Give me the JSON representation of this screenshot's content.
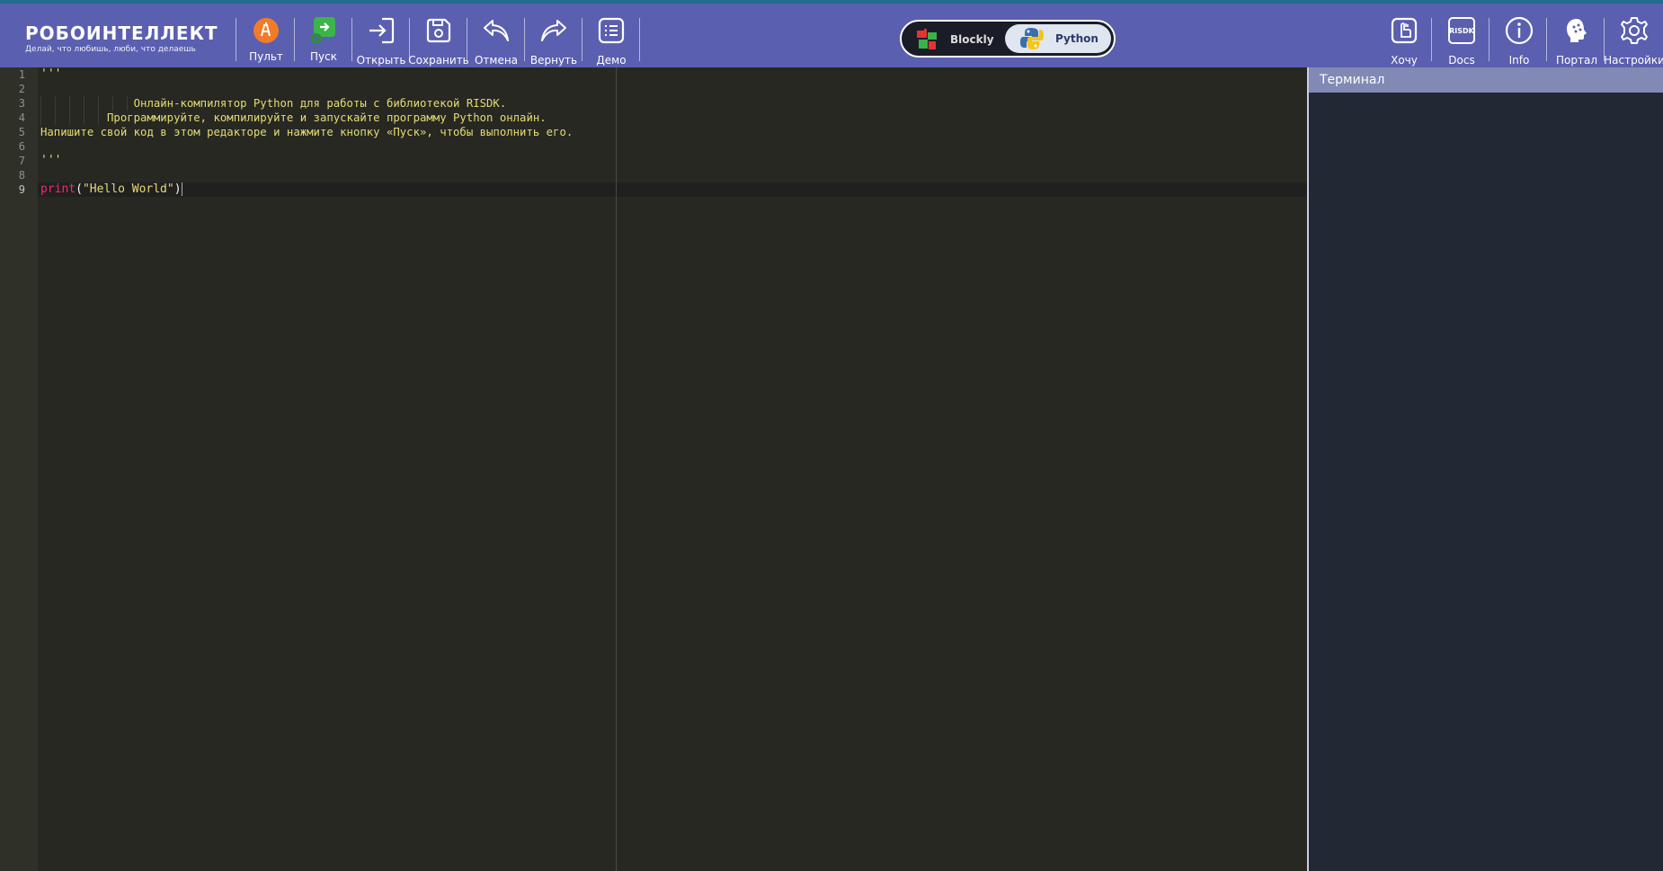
{
  "brand": {
    "name": "РОБОИНТЕЛЛЕКТ",
    "tagline": "Делай, что любишь, люби, что делаешь"
  },
  "toolbar": {
    "left_buttons": [
      {
        "label": "Пульт",
        "icon": "remote-control-icon"
      },
      {
        "label": "Пуск",
        "icon": "run-icon"
      },
      {
        "label": "Открыть",
        "icon": "open-icon"
      },
      {
        "label": "Сохранить",
        "icon": "save-icon"
      },
      {
        "label": "Отмена",
        "icon": "undo-icon"
      },
      {
        "label": "Вернуть",
        "icon": "redo-icon"
      },
      {
        "label": "Демо",
        "icon": "demo-list-icon"
      }
    ],
    "right_buttons": [
      {
        "label": "Хочу",
        "icon": "hand-pointer-icon"
      },
      {
        "label": "Docs",
        "icon": "risdk-docs-icon",
        "icon_text": "RISDK"
      },
      {
        "label": "Info",
        "icon": "info-icon"
      },
      {
        "label": "Портал",
        "icon": "portal-icon"
      },
      {
        "label": "Настройки",
        "icon": "gear-icon"
      }
    ]
  },
  "mode_toggle": {
    "options": [
      "Blockly",
      "Python"
    ],
    "selected": "Python"
  },
  "editor": {
    "line_numbers": [
      "1",
      "2",
      "3",
      "4",
      "5",
      "6",
      "7",
      "8",
      "9"
    ],
    "active_line": "9",
    "lines": [
      "'''",
      "",
      "              Онлайн-компилятор Python для работы с библиотекой RISDK.",
      "          Программируйте, компилируйте и запускайте программу Python онлайн.",
      "Напишите свой код в этом редакторе и нажмите кнопку «Пуск», чтобы выполнить его.",
      "",
      "'''",
      "",
      ""
    ],
    "print_line": {
      "keyword": "print",
      "open": "(",
      "string": "\"Hello World\"",
      "close": ")"
    }
  },
  "terminal": {
    "title": "Терминал"
  },
  "colors": {
    "toolbar": "#5b5fb0",
    "editor_bg": "#272822",
    "terminal_bg": "#222834",
    "string": "#e6db74",
    "keyword": "#f92672"
  }
}
